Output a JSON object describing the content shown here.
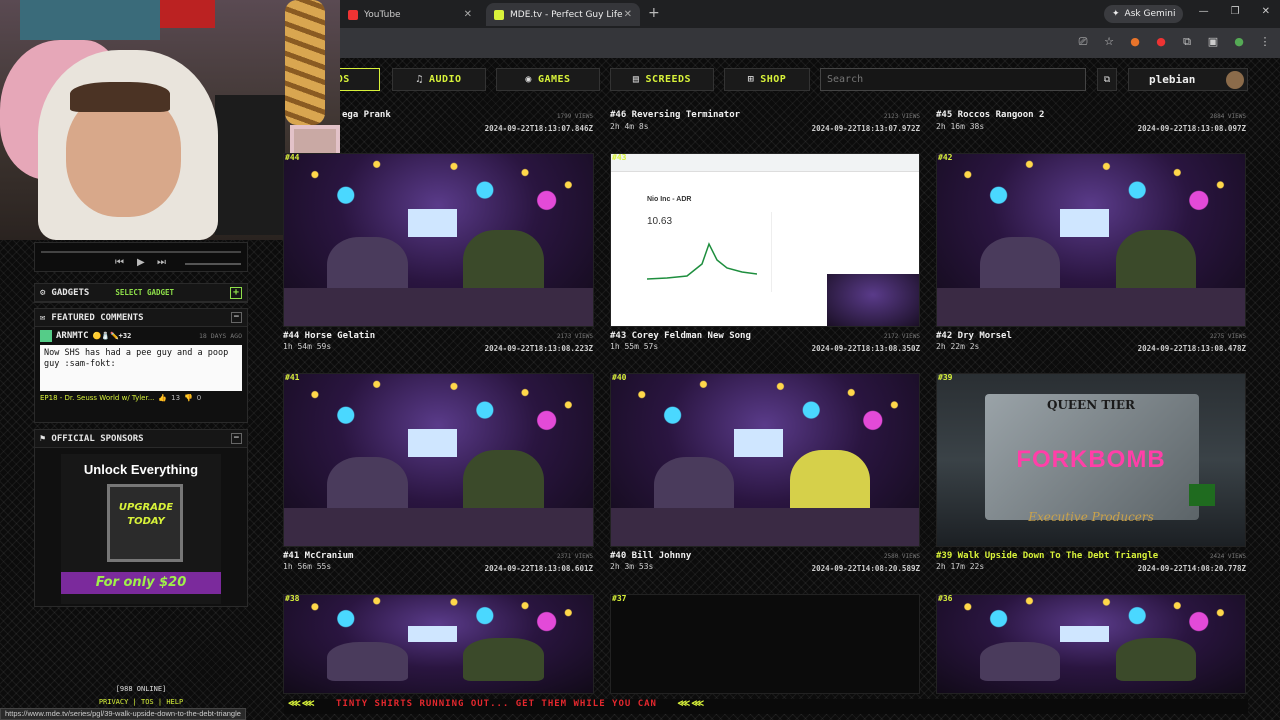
{
  "browser": {
    "tabs": [
      {
        "title": "YouTube",
        "active": false
      },
      {
        "title": "MDE.tv - Perfect Guy Life",
        "active": true
      }
    ],
    "ask_gemini": "Ask Gemini",
    "status_url": "https://www.mde.tv/series/pgl/39-walk-upside-down-to-the-debt-triangle"
  },
  "nav": {
    "items": [
      {
        "label": "EOS",
        "icon": "video-icon",
        "active": true
      },
      {
        "label": "AUDIO",
        "icon": "music-note-icon"
      },
      {
        "label": "GAMES",
        "icon": "gamepad-icon"
      },
      {
        "label": "SCREEDS",
        "icon": "document-icon"
      },
      {
        "label": "SHOP",
        "icon": "cart-icon"
      }
    ],
    "search_placeholder": "Search",
    "username": "plebian"
  },
  "sidebar": {
    "gadgets": {
      "title": "GADGETS",
      "select_label": "SELECT GADGET"
    },
    "featured": {
      "title": "FEATURED COMMENTS",
      "user": "ARNMTC",
      "user_badges": "🟡🧂✏️+32",
      "ago": "18 DAYS AGO",
      "body": "Now SHS has had a pee guy and a poop guy :sam-fokt:",
      "episode": "EP18 - Dr. Seuss World w/ Tyler...",
      "likes": "13",
      "dislikes": "0"
    },
    "sponsors": {
      "title": "OFFICIAL SPONSORS",
      "headline": "Unlock Everything",
      "upgrade": "UPGRADE TODAY",
      "price": "For only $20"
    },
    "footer": {
      "online": "[988 ONLINE]",
      "links": [
        "PRIVACY",
        "TOS",
        "HELP"
      ]
    }
  },
  "videos": [
    {
      "title": "ega Prank",
      "duration": "",
      "date": "2024-09-22T18:13:07.846Z",
      "views": "1799 VIEWS"
    },
    {
      "title": "#46 Reversing Terminator",
      "duration": "2h 4m 8s",
      "date": "2024-09-22T18:13:07.972Z",
      "views": "2123 VIEWS"
    },
    {
      "title": "#45 Roccos Rangoon 2",
      "duration": "2h 16m 38s",
      "date": "2024-09-22T18:13:08.097Z",
      "views": "2884 VIEWS"
    },
    {
      "num": "#44",
      "title": "#44 Horse Gelatin",
      "duration": "1h 54m 59s",
      "date": "2024-09-22T18:13:08.223Z",
      "views": "2173 VIEWS"
    },
    {
      "num": "#43",
      "title": "#43 Corey Feldman New Song",
      "duration": "1h 55m 57s",
      "date": "2024-09-22T18:13:08.350Z",
      "views": "2172 VIEWS"
    },
    {
      "num": "#42",
      "title": "#42 Dry Morsel",
      "duration": "2h 22m 2s",
      "date": "2024-09-22T18:13:08.478Z",
      "views": "2275 VIEWS"
    },
    {
      "num": "#41",
      "title": "#41 McCranium",
      "duration": "1h 56m 55s",
      "date": "2024-09-22T18:13:08.601Z",
      "views": "2371 VIEWS"
    },
    {
      "num": "#40",
      "title": "#40 Bill Johnny",
      "duration": "2h 3m 53s",
      "date": "2024-09-22T14:08:20.589Z",
      "views": "2580 VIEWS"
    },
    {
      "num": "#39",
      "title": "#39 Walk Upside Down To The Debt Triangle",
      "duration": "2h 17m 22s",
      "date": "2024-09-22T14:08:20.778Z",
      "views": "2424 VIEWS"
    },
    {
      "num": "#38"
    },
    {
      "num": "#37"
    },
    {
      "num": "#36"
    }
  ],
  "thumb_text": {
    "forkbomb_top": "QUEEN TIER",
    "forkbomb_main": "FORKBOMB",
    "forkbomb_bottom": "Executive Producers",
    "stock_title": "Nio Inc - ADR",
    "stock_price": "10.63"
  },
  "ticker": {
    "sep": "⋘⋘",
    "message": "TINTY SHIRTS RUNNING OUT... GET THEM WHILE YOU CAN"
  },
  "colors": {
    "accent": "#d8f23a",
    "ticker_red": "#e4282e",
    "pink": "#ff3fa8"
  }
}
